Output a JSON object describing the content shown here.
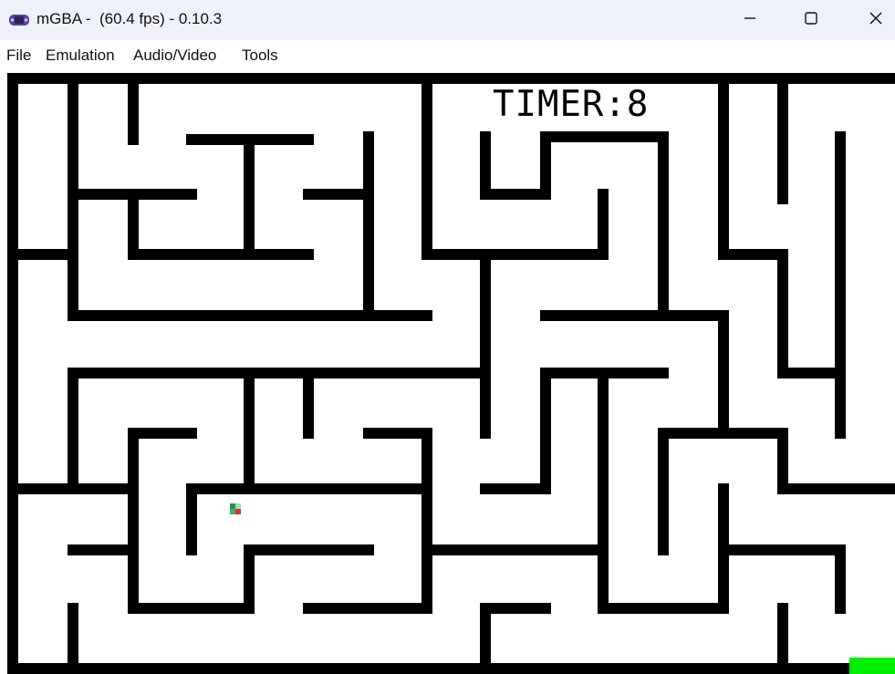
{
  "window": {
    "title": "mGBA -  (60.4 fps) - 0.10.3",
    "app_icon": "gameboy-advance-icon",
    "controls": [
      "minimize-icon",
      "maximize-icon",
      "close-icon"
    ]
  },
  "menu": {
    "items": [
      "File",
      "Emulation",
      "Audio/Video",
      "Tools"
    ]
  },
  "game": {
    "timer_text": "TIMER:8",
    "colors": {
      "wall": "#000000",
      "floor": "#ffffff",
      "player": "#2e8b57",
      "goal": "#00ee00"
    }
  }
}
